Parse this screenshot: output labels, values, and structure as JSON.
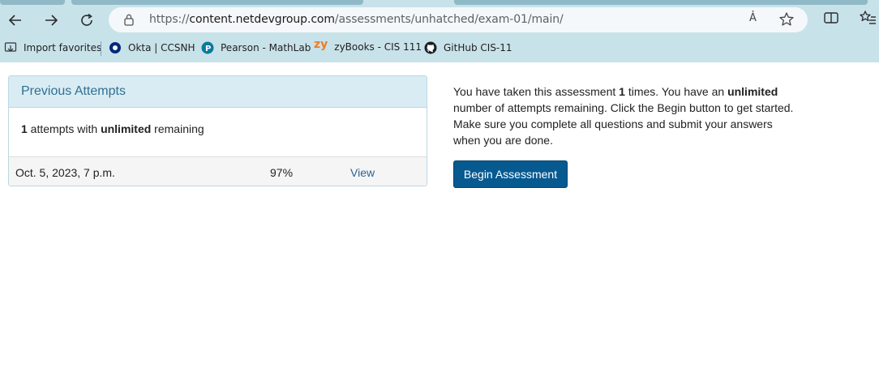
{
  "browser": {
    "url_prefix": "https://",
    "url_host": "content.netdevgroup.com",
    "url_path": "/assessments/unhatched/exam-01/main/",
    "read_aloud_label": "A҆",
    "favorites": [
      {
        "label": "Import favorites",
        "icon": "import-favorites-icon"
      },
      {
        "label": "Okta | CCSNH",
        "icon": "okta-icon"
      },
      {
        "label": "Pearson - MathLab",
        "icon": "pearson-icon"
      },
      {
        "label": "zyBooks - CIS 111",
        "icon": "zybooks-icon",
        "icon_text": "zy",
        "icon_color": "#f07b1f"
      },
      {
        "label": "GitHub CIS-11",
        "icon": "github-icon"
      }
    ]
  },
  "attempts_panel": {
    "title": "Previous Attempts",
    "summary": {
      "count": "1",
      "middle": " attempts with ",
      "limit": "unlimited",
      "suffix": " remaining"
    },
    "rows": [
      {
        "date": "Oct. 5, 2023, 7 p.m.",
        "score": "97%",
        "action": "View"
      }
    ]
  },
  "info": {
    "p1": "You have taken this assessment ",
    "count": "1",
    "p2": " times. You have an ",
    "limit": "unlimited",
    "p3": " number of attempts remaining. Click the Begin button to get started. Make sure you complete all questions and submit your answers when you are done."
  },
  "begin_button": {
    "label": "Begin Assessment"
  },
  "colors": {
    "chrome": "#c8e2ea",
    "panel_heading": "#d9ecf4",
    "panel_title": "#31708f",
    "button": "#075a90",
    "link": "#2a6496"
  }
}
